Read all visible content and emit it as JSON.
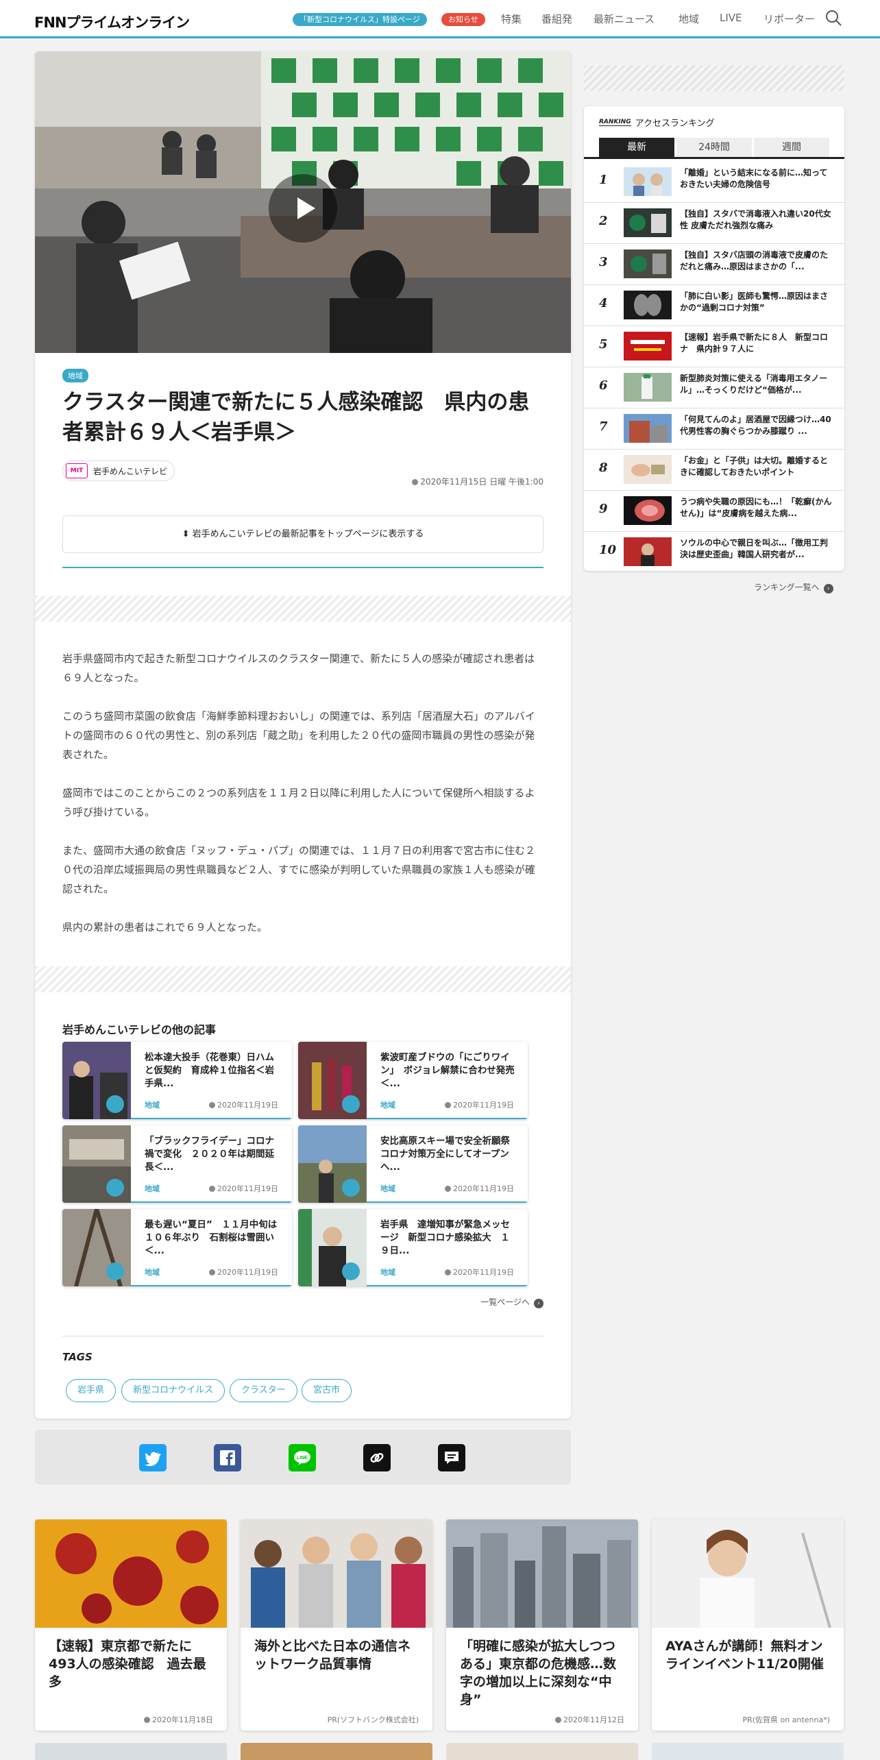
{
  "header": {
    "logo": "FNNプライムオンライン",
    "corona_pill": "「新型コロナウイルス」特設ページ",
    "notice_pill": "お知らせ",
    "nav": [
      "特集",
      "番組発",
      "最新ニュース",
      "地域",
      "LIVE",
      "リポーター"
    ]
  },
  "article": {
    "category": "地域",
    "title": "クラスター関連で新たに５人感染確認　県内の患者累計６９人＜岩手県＞",
    "source": "岩手めんこいテレビ",
    "source_logo": "MIT",
    "date": "2020年11月15日 日曜 午後1:00",
    "pin_text": "岩手めんこいテレビの最新記事をトップページに表示する",
    "paragraphs": [
      "岩手県盛岡市内で起きた新型コロナウイルスのクラスター関連で、新たに５人の感染が確認され患者は６９人となった。",
      "このうち盛岡市菜園の飲食店「海鮮季節料理おおいし」の関連では、系列店「居酒屋大石」のアルバイトの盛岡市の６０代の男性と、別の系列店「蔵之助」を利用した２０代の盛岡市職員の男性の感染が発表された。",
      "盛岡市ではこのことからこの２つの系列店を１１月２日以降に利用した人について保健所へ相談するよう呼び掛けている。",
      "また、盛岡市大通の飲食店「ヌッフ・デュ・パプ」の関連では、１１月７日の利用客で宮古市に住む２０代の沿岸広域振興局の男性県職員など２人、すでに感染が判明していた県職員の家族１人も感染が確認された。",
      "県内の累計の患者はこれで６９人となった。"
    ]
  },
  "more": {
    "heading": "岩手めんこいテレビの他の記事",
    "list_link": "一覧ページへ",
    "cards": [
      {
        "title": "松本達大投手（花巻東）日ハムと仮契約　育成枠１位指名＜岩手県...",
        "tag": "地域",
        "date": "2020年11月19日"
      },
      {
        "title": "紫波町産ブドウの「にごりワイン」　ボジョレ解禁に合わせ発売＜...",
        "tag": "地域",
        "date": "2020年11月19日"
      },
      {
        "title": "「ブラックフライデー」コロナ禍で変化　２０２０年は期間延長＜...",
        "tag": "地域",
        "date": "2020年11月19日"
      },
      {
        "title": "安比高原スキー場で安全祈願祭　コロナ対策万全にしてオープンへ...",
        "tag": "地域",
        "date": "2020年11月19日"
      },
      {
        "title": "最も遅い“夏日”　１１月中旬は１０６年ぶり　石割桜は雪囲い＜...",
        "tag": "地域",
        "date": "2020年11月19日"
      },
      {
        "title": "岩手県　達増知事が緊急メッセージ　新型コロナ感染拡大　１９日...",
        "tag": "地域",
        "date": "2020年11月19日"
      }
    ]
  },
  "tags": {
    "heading": "TAGS",
    "items": [
      "岩手県",
      "新型コロナウイルス",
      "クラスター",
      "宮古市"
    ]
  },
  "ranking": {
    "label": "RANKING",
    "title": "アクセスランキング",
    "tabs": [
      "最新",
      "24時間",
      "週間"
    ],
    "items": [
      {
        "rank": "1",
        "text": "「離婚」という結末になる前に…知っておきたい夫婦の危険信号"
      },
      {
        "rank": "2",
        "text": "【独自】スタバで消毒液入れ違い20代女性 皮膚ただれ強烈な痛み"
      },
      {
        "rank": "3",
        "text": "【独自】スタバ店頭の消毒液で皮膚のただれと痛み…原因はまさかの「..."
      },
      {
        "rank": "4",
        "text": "「肺に白い影」医師も驚愕…原因はまさかの“過剰コロナ対策”"
      },
      {
        "rank": "5",
        "text": "【速報】岩手県で新たに８人　新型コロナ　県内計９７人に"
      },
      {
        "rank": "6",
        "text": "新型肺炎対策に使える「消毒用エタノール」…そっくりだけど“価格が..."
      },
      {
        "rank": "7",
        "text": "「何見てんのよ」居酒屋で因縁つけ…40代男性客の胸ぐらつかみ膝蹴り ..."
      },
      {
        "rank": "8",
        "text": "「お金」と「子供」は大切。離婚するときに確認しておきたいポイント"
      },
      {
        "rank": "9",
        "text": "うつ病や失職の原因にも…！「乾癬(かんせん)」は“皮膚病を越えた病..."
      },
      {
        "rank": "10",
        "text": "ソウルの中心で親日を叫ぶ…「徴用工判決は歴史歪曲」韓国人研究者が..."
      }
    ],
    "more_link": "ランキング一覧へ"
  },
  "recommend": [
    {
      "title": "【速報】東京都で新たに493人の感染確認　過去最多",
      "meta": "2020年11月18日"
    },
    {
      "title": "海外と比べた日本の通信ネットワーク品質事情",
      "meta": "PR(ソフトバンク株式会社)"
    },
    {
      "title": "「明確に感染が拡大しつつある」東京都の危機感…数字の増加以上に深刻な“中身”",
      "meta": "2020年11月12日"
    },
    {
      "title": "AYAさんが講師！無料オンラインイベント11/20開催",
      "meta": "PR(佐賀県 on antenna*)"
    }
  ],
  "colors": {
    "accent": "#3aa9c9",
    "notice": "#e74c3c",
    "twitter": "#1da1f2",
    "facebook": "#3b5998",
    "line": "#00c300"
  }
}
